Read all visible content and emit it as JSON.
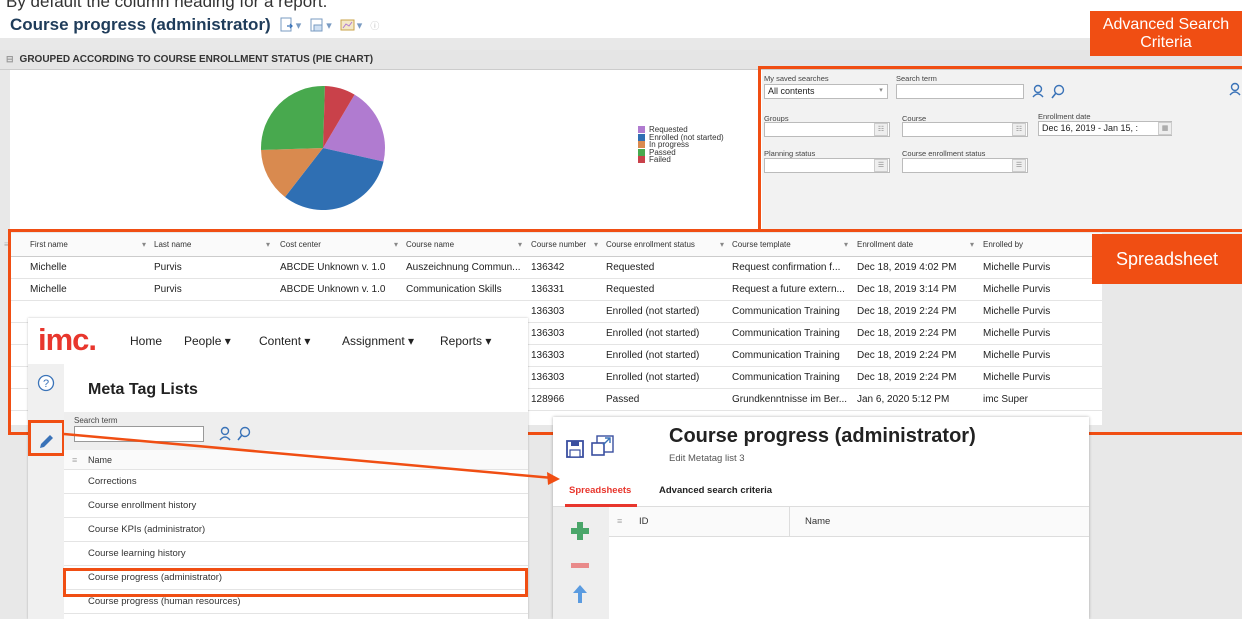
{
  "cut_text": "By default the column heading for a report.",
  "report": {
    "title": "Course progress (administrator)",
    "section_title": "GROUPED ACCORDING TO COURSE ENROLLMENT STATUS (PIE CHART)"
  },
  "chart_data": {
    "type": "pie",
    "categories": [
      "Requested",
      "Enrolled (not started)",
      "In progress",
      "Passed",
      "Failed"
    ],
    "values": [
      20,
      32,
      14,
      26,
      8
    ],
    "colors": [
      "#b07bd0",
      "#2f6fb3",
      "#d98a4f",
      "#48a94e",
      "#c9414a"
    ],
    "legend_position": "right"
  },
  "advanced_search": {
    "saved_searches_label": "My saved searches",
    "saved_searches_value": "All contents",
    "search_term_label": "Search term",
    "search_term_value": "",
    "groups_label": "Groups",
    "course_label": "Course",
    "enrollment_date_label": "Enrollment date",
    "enrollment_date_value": "Dec 16, 2019 - Jan 15, :",
    "planning_status_label": "Planning status",
    "course_enrollment_status_label": "Course enrollment status"
  },
  "spreadsheet": {
    "columns": [
      "First name",
      "Last name",
      "Cost center",
      "Course name",
      "Course number",
      "Course enrollment status",
      "Course template",
      "Enrollment date",
      "Enrolled by"
    ],
    "rows": [
      [
        "Michelle",
        "Purvis",
        "ABCDE Unknown v. 1.0",
        "Auszeichnung Commun...",
        "136342",
        "Requested",
        "Request confirmation f...",
        "Dec 18, 2019 4:02 PM",
        "Michelle Purvis"
      ],
      [
        "Michelle",
        "Purvis",
        "ABCDE Unknown v. 1.0",
        "Communication Skills",
        "136331",
        "Requested",
        "Request a future extern...",
        "Dec 18, 2019 3:14 PM",
        "Michelle Purvis"
      ],
      [
        "",
        "",
        "",
        "",
        "136303",
        "Enrolled (not started)",
        "Communication Training",
        "Dec 18, 2019 2:24 PM",
        "Michelle Purvis"
      ],
      [
        "",
        "",
        "",
        "",
        "136303",
        "Enrolled (not started)",
        "Communication Training",
        "Dec 18, 2019 2:24 PM",
        "Michelle Purvis"
      ],
      [
        "",
        "",
        "",
        "",
        "136303",
        "Enrolled (not started)",
        "Communication Training",
        "Dec 18, 2019 2:24 PM",
        "Michelle Purvis"
      ],
      [
        "",
        "",
        "",
        "",
        "136303",
        "Enrolled (not started)",
        "Communication Training",
        "Dec 18, 2019 2:24 PM",
        "Michelle Purvis"
      ],
      [
        "",
        "",
        "",
        "",
        "128966",
        "Passed",
        "Grundkenntnisse im Ber...",
        "Jan 6, 2020 5:12 PM",
        "imc Super"
      ]
    ]
  },
  "callouts": {
    "advanced": "Advanced Search Criteria",
    "spreadsheet": "Spreadsheet"
  },
  "meta_tag_window": {
    "logo": "imc.",
    "nav": [
      "Home",
      "People ▾",
      "Content ▾",
      "Assignment ▾",
      "Reports ▾"
    ],
    "title": "Meta Tag Lists",
    "search_label": "Search term",
    "search_value": "",
    "list_header": "Name",
    "items": [
      "Corrections",
      "Course enrollment history",
      "Course KPIs (administrator)",
      "Course learning history",
      "Course progress (administrator)",
      "Course progress (human resources)"
    ]
  },
  "course_window": {
    "title": "Course progress (administrator)",
    "subtitle": "Edit   Metatag list 3",
    "tabs": [
      "Spreadsheets",
      "Advanced search criteria"
    ],
    "grid_headers": [
      "ID",
      "Name"
    ]
  }
}
